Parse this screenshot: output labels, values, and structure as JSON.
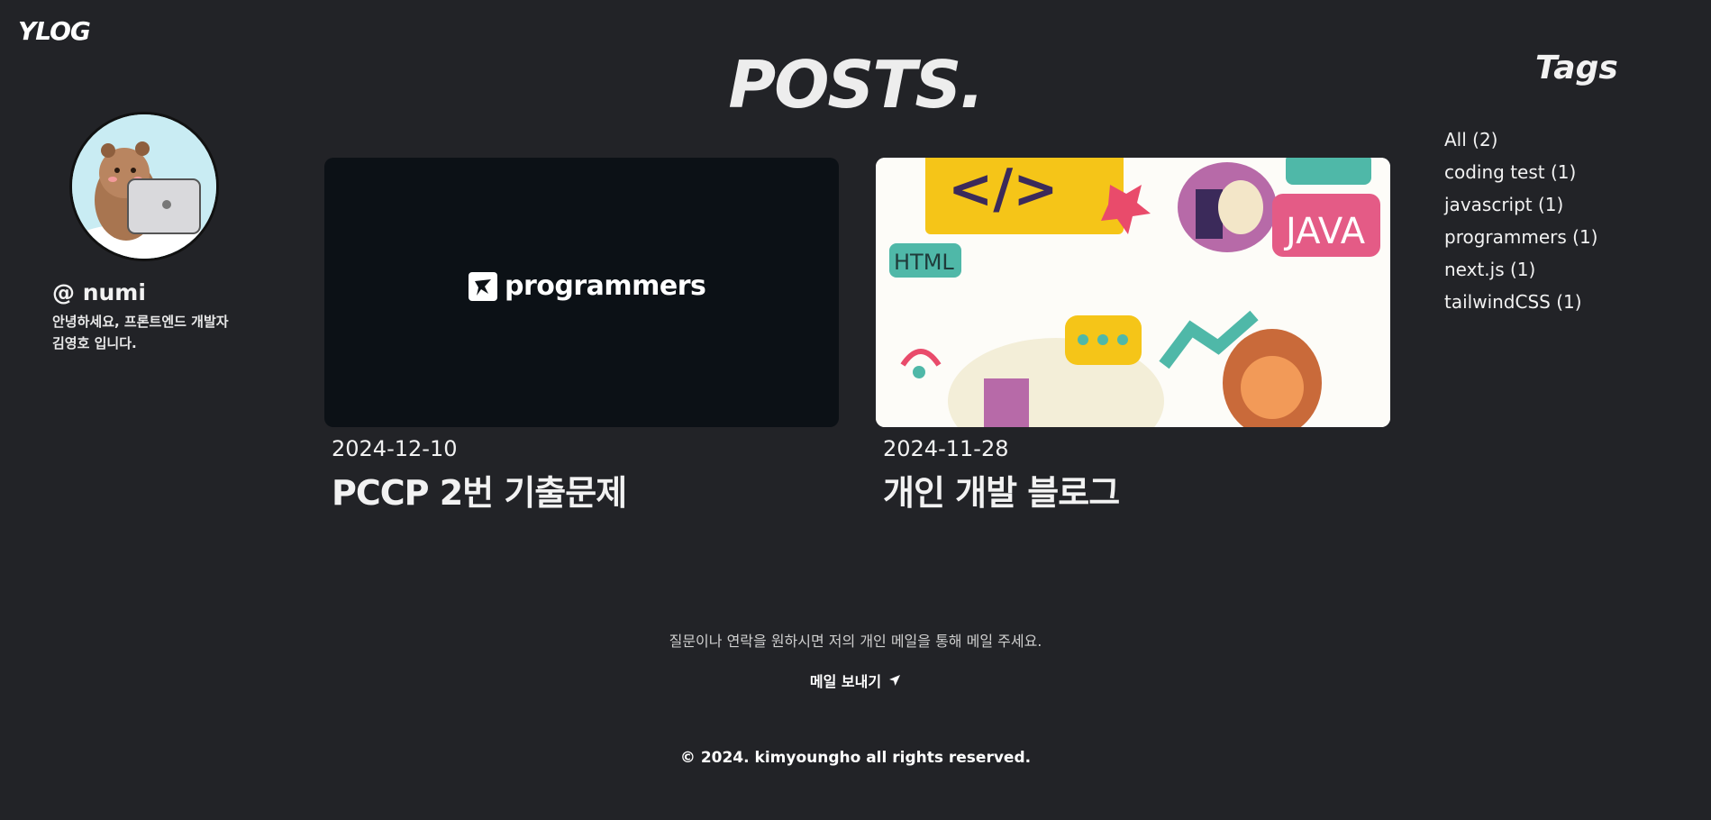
{
  "header": {
    "logo": "YLOG",
    "page_title": "POSTS."
  },
  "profile": {
    "handle": "@ numi",
    "bio_line1": "안녕하세요, 프론트엔드 개발자",
    "bio_line2": "김영호 입니다."
  },
  "posts": [
    {
      "date": "2024-12-10",
      "title": "PCCP 2번 기출문제",
      "thumbnail_text": "programmers"
    },
    {
      "date": "2024-11-28",
      "title": "개인 개발 블로그",
      "thumbnail_text": "HTML",
      "thumbnail_text2": "JAVA"
    }
  ],
  "tags": {
    "heading": "Tags",
    "items": [
      {
        "label": "All (2)"
      },
      {
        "label": "coding test (1)"
      },
      {
        "label": "javascript (1)"
      },
      {
        "label": "programmers (1)"
      },
      {
        "label": "next.js (1)"
      },
      {
        "label": "tailwindCSS (1)"
      }
    ]
  },
  "footer": {
    "contact_text": "질문이나 연락을 원하시면 저의 개인 메일을 통해 메일 주세요.",
    "mail_button": "메일 보내기",
    "copyright": "© 2024. kimyoungho all rights reserved."
  },
  "colors": {
    "background": "#222327",
    "text": "#f2f2f2",
    "card_dark": "#0c1116"
  },
  "icons": {
    "mail": "send-arrow-icon"
  }
}
